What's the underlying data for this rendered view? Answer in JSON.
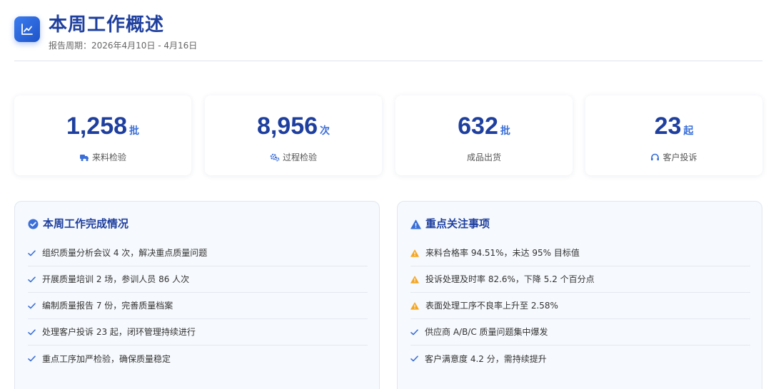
{
  "header": {
    "title": "本周工作概述",
    "subtitle": "报告周期：2026年4月10日 - 4月16日",
    "logo_icon": "line-chart-icon"
  },
  "stats": [
    {
      "value": "1,258",
      "unit": "批",
      "label": "来料检验",
      "icon": "truck-icon"
    },
    {
      "value": "8,956",
      "unit": "次",
      "label": "过程检验",
      "icon": "cogs-icon"
    },
    {
      "value": "632",
      "unit": "批",
      "label": "成品出货",
      "icon": ""
    },
    {
      "value": "23",
      "unit": "起",
      "label": "客户投诉",
      "icon": "headset-icon"
    }
  ],
  "completed": {
    "title": "本周工作完成情况",
    "icon": "check-circle-icon",
    "items": [
      {
        "text": "组织质量分析会议 4 次，解决重点质量问题",
        "icon": "check-icon"
      },
      {
        "text": "开展质量培训 2 场，参训人员 86 人次",
        "icon": "check-icon"
      },
      {
        "text": "编制质量报告 7 份，完善质量档案",
        "icon": "check-icon"
      },
      {
        "text": "处理客户投诉 23 起，闭环管理持续进行",
        "icon": "check-icon"
      },
      {
        "text": "重点工序加严检验，确保质量稳定",
        "icon": "check-icon"
      }
    ]
  },
  "focus": {
    "title": "重点关注事项",
    "icon": "warning-icon",
    "items": [
      {
        "text": "来料合格率 94.51%，未达 95% 目标值",
        "icon": "warning-icon"
      },
      {
        "text": "投诉处理及时率 82.6%，下降 5.2 个百分点",
        "icon": "warning-icon"
      },
      {
        "text": "表面处理工序不良率上升至 2.58%",
        "icon": "warning-icon"
      },
      {
        "text": "供应商 A/B/C 质量问题集中爆发",
        "icon": "check-icon"
      },
      {
        "text": "客户满意度 4.2 分，需持续提升",
        "icon": "check-icon"
      }
    ]
  },
  "colors": {
    "primary": "#1e3f9e",
    "accent": "#3a6fd8",
    "warning": "#f5a623"
  }
}
